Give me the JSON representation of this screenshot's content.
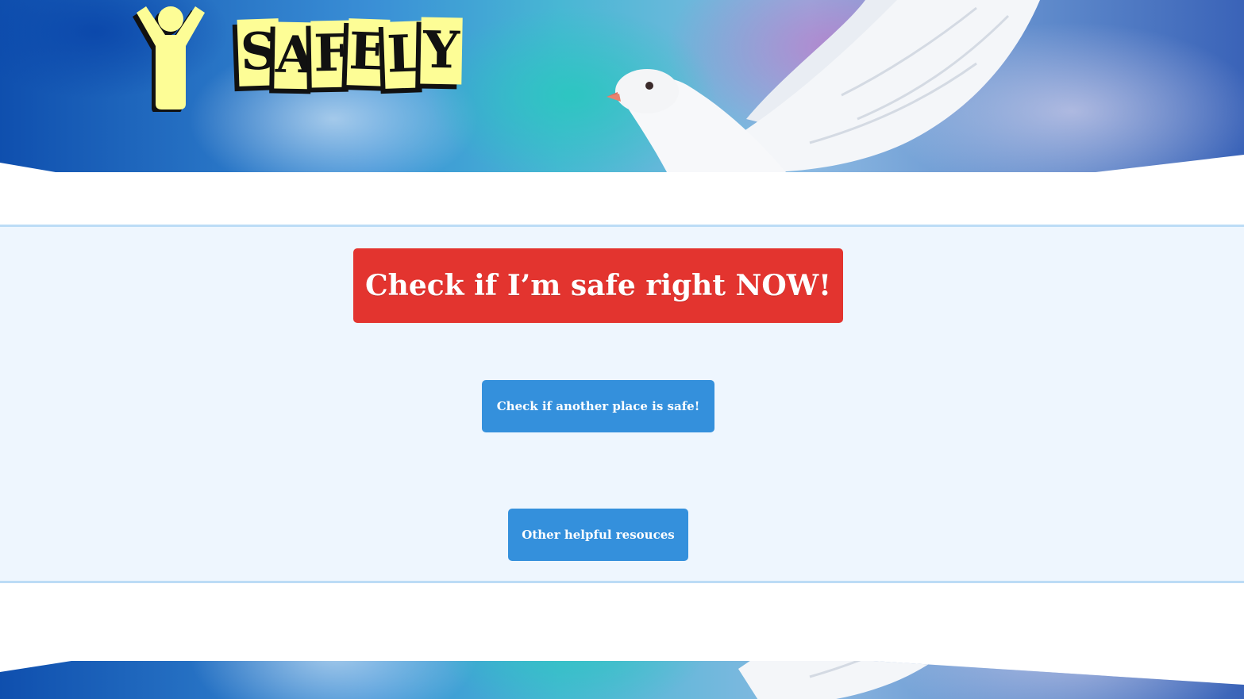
{
  "header": {
    "logo_letters": [
      "S",
      "A",
      "F",
      "E",
      "L",
      "Y"
    ],
    "logo_figure_icon": "person-arms-raised-icon",
    "banner_icon": "dove-icon"
  },
  "main": {
    "primary_button_label": "Check if I’m safe right NOW!",
    "other_place_button_label": "Check if another place is safe!",
    "resources_button_label": "Other helpful resouces"
  },
  "colors": {
    "primary_button": "#e3342f",
    "secondary_button": "#3490dc",
    "section_background": "#eef6fe",
    "section_border": "#bcdcf6",
    "logo_yellow": "#fdfd96"
  }
}
